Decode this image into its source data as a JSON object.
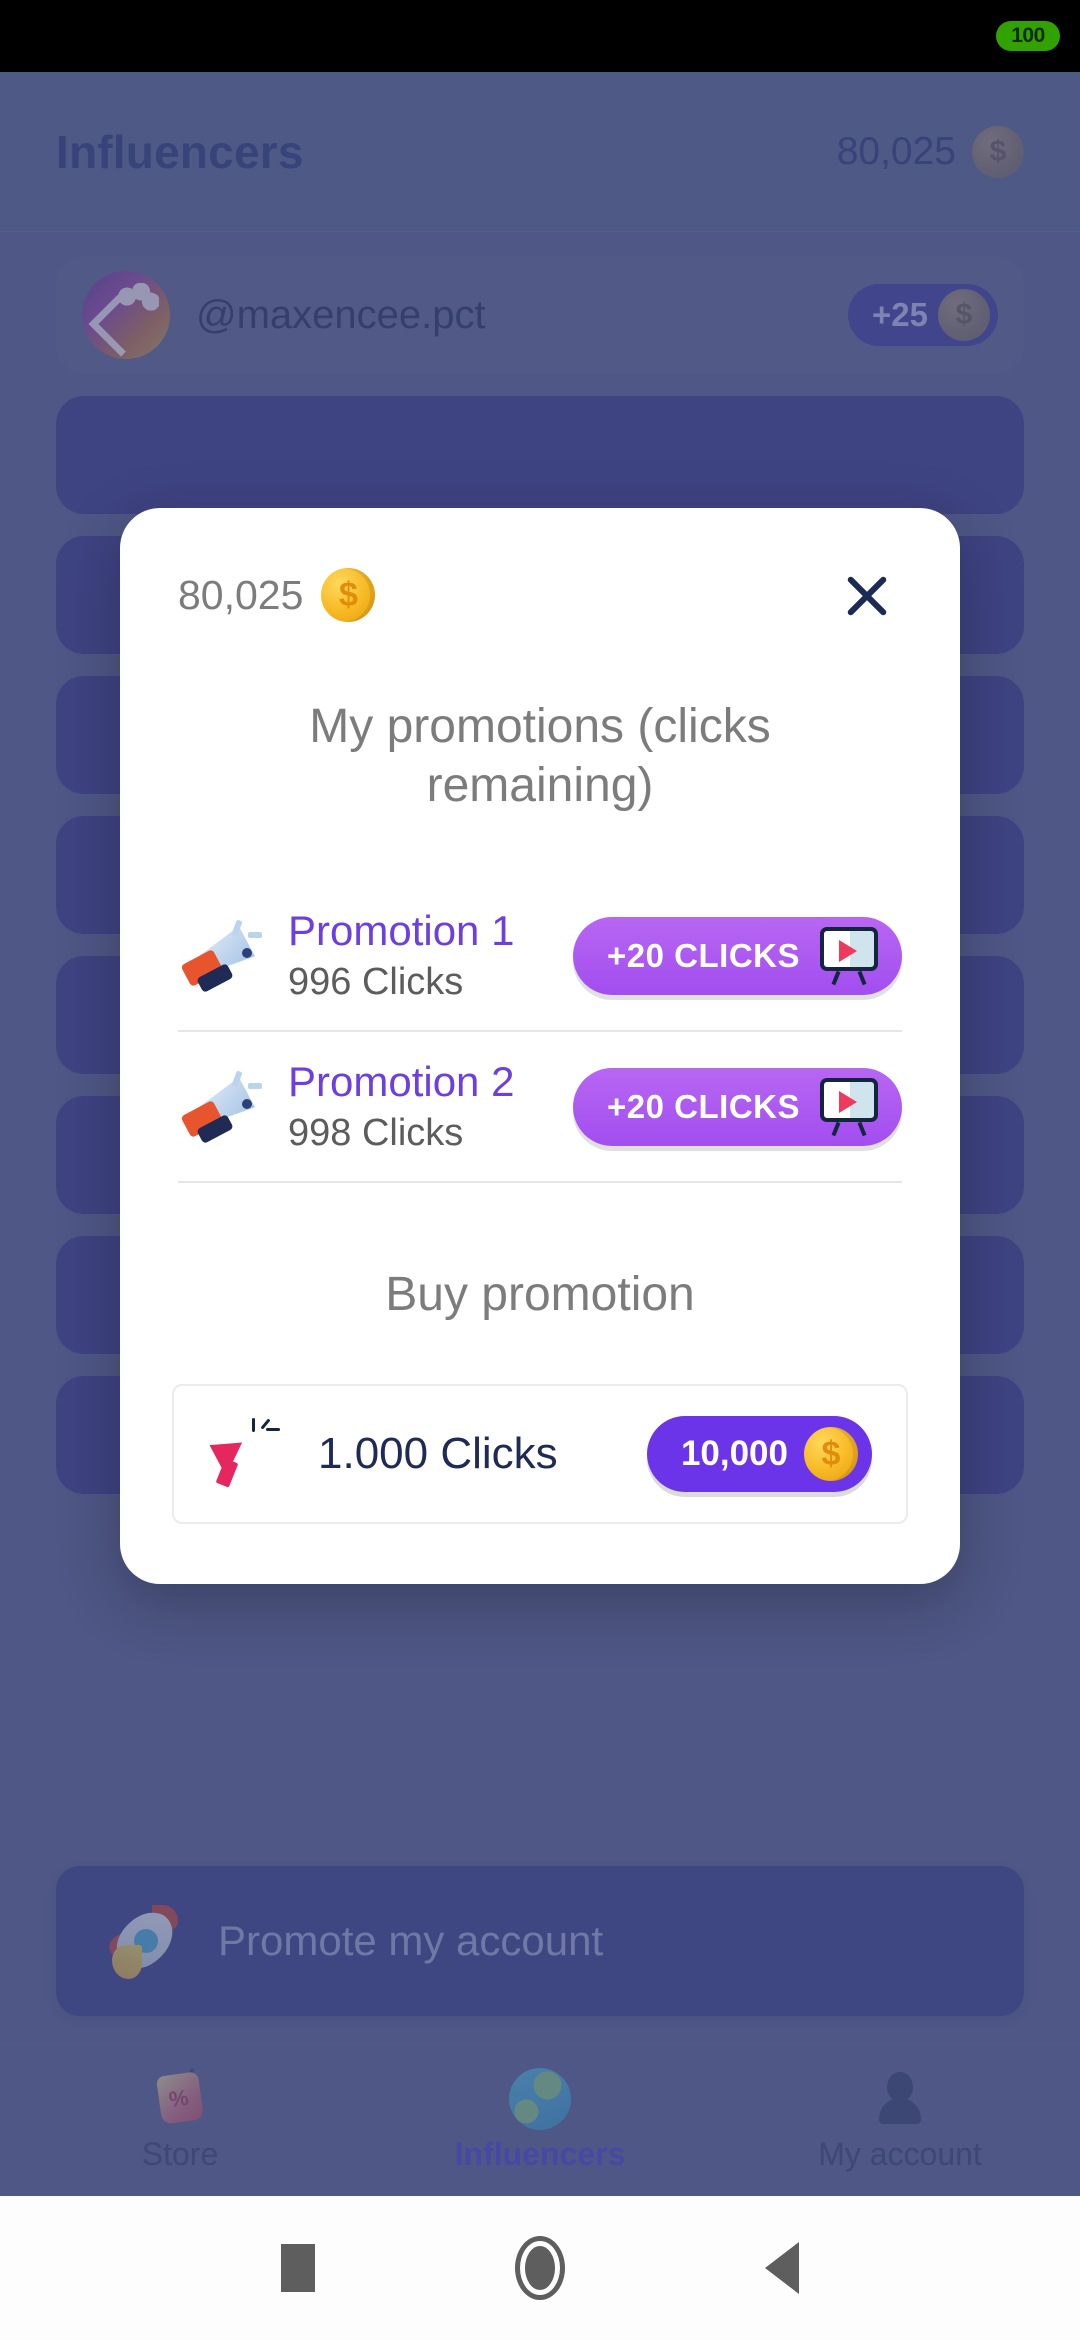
{
  "statusbar": {
    "battery_label": "100"
  },
  "header": {
    "title": "Influencers",
    "coins": "80,025",
    "coin_icon": "coin-icon"
  },
  "influencer_list": [
    {
      "name": "@maxencee.pct",
      "reward": "+25"
    }
  ],
  "promote_cta": {
    "label": "Promote my account",
    "icon": "rocket-icon"
  },
  "bottom_nav": {
    "items": [
      {
        "label": "Store",
        "icon": "price-tag-icon",
        "active": false
      },
      {
        "label": "Influencers",
        "icon": "globe-icon",
        "active": true
      },
      {
        "label": "My account",
        "icon": "person-icon",
        "active": false
      }
    ]
  },
  "modal": {
    "coins": "80,025",
    "close_icon": "close-icon",
    "title": "My promotions (clicks remaining)",
    "promotions": [
      {
        "name": "Promotion 1",
        "clicks": "996 Clicks",
        "button_label": "+20 CLICKS",
        "button_icon": "video-ad-icon"
      },
      {
        "name": "Promotion 2",
        "clicks": "998 Clicks",
        "button_label": "+20 CLICKS",
        "button_icon": "video-ad-icon"
      }
    ],
    "buy_title": "Buy promotion",
    "buy_items": [
      {
        "label": "1.000 Clicks",
        "icon": "cursor-click-icon",
        "price": "10,000",
        "price_icon": "coin-icon"
      }
    ]
  },
  "colors": {
    "app_background": "#4e5885",
    "accent_purple": "#6d3fe0",
    "button_purple": "#a24ef0",
    "price_purple": "#6c34e8",
    "coin_gold": "#f6b823",
    "navy": "#1c2b6b",
    "modal_background": "#ffffff"
  },
  "android_nav": {
    "recents": "square-recents-icon",
    "home": "circle-home-icon",
    "back": "triangle-back-icon"
  }
}
